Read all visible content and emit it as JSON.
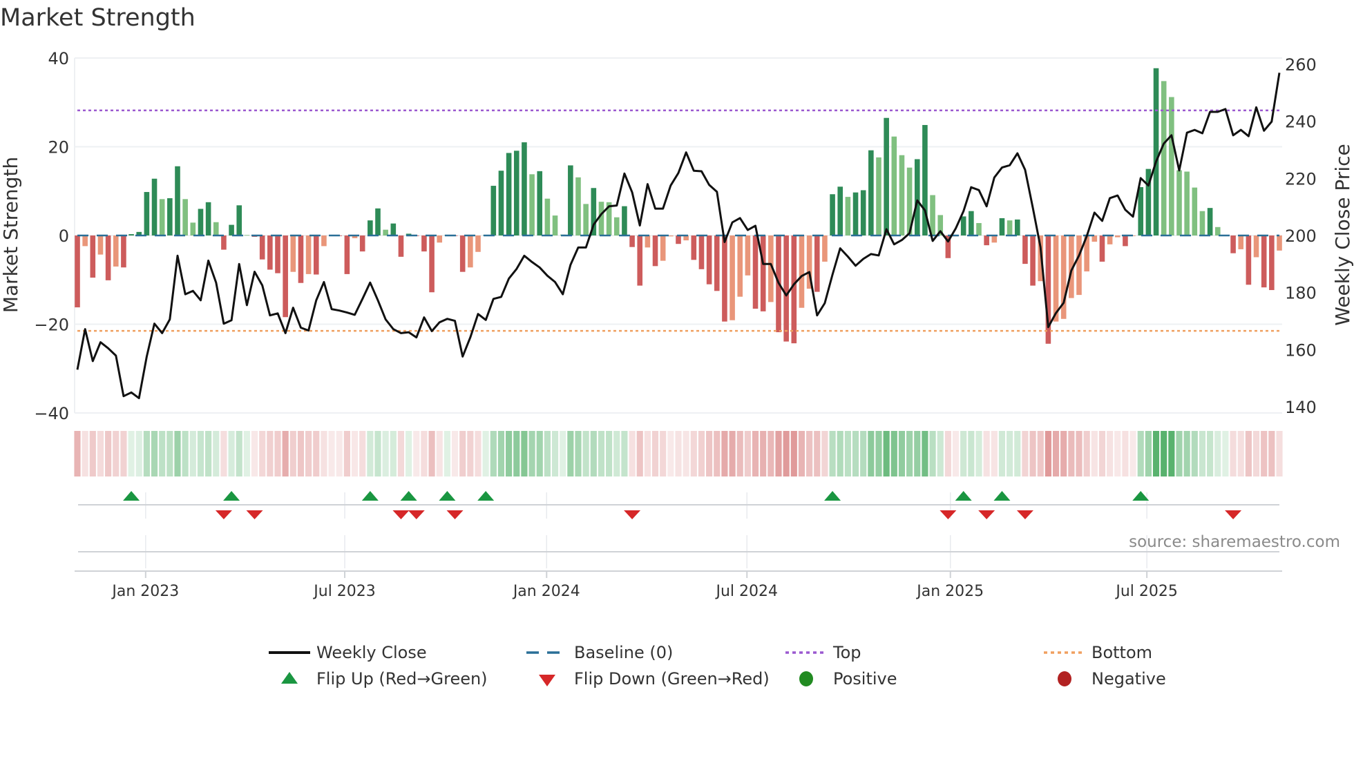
{
  "title": "Market Strength",
  "source": "source: sharemaestro.com",
  "colors": {
    "pos_strong": "#2e8b57",
    "pos_weak": "#80c080",
    "neg_strong": "#cd5c5c",
    "neg_weak": "#e9967a",
    "close": "#111111",
    "baseline": "#2a6f97",
    "top": "#9b59d0",
    "bottom": "#f0a060",
    "flip_up": "#1a9641",
    "flip_down": "#d62728",
    "positive": "#228b22",
    "negative": "#b22222"
  },
  "chart_data": {
    "type": "bar",
    "title": "Market Strength",
    "ylabel": "Market Strength",
    "y2label": "Weekly Close Price",
    "ylim": [
      -40,
      40
    ],
    "y2lim": [
      140,
      260
    ],
    "yticks": [
      40,
      20,
      0,
      -20,
      -40
    ],
    "ytick_labels": [
      "40",
      "20",
      "0",
      "−20",
      "−40"
    ],
    "y2ticks": [
      260,
      240,
      220,
      200,
      180,
      160,
      140
    ],
    "y2tick_labels": [
      "260",
      "240",
      "220",
      "200",
      "180",
      "160",
      "140"
    ],
    "xticks": [
      {
        "label": "Jan 2023",
        "week": 8.86
      },
      {
        "label": "Jul 2023",
        "week": 34.7
      },
      {
        "label": "Jan 2024",
        "week": 60.9
      },
      {
        "label": "Jul 2024",
        "week": 86.9
      },
      {
        "label": "Jan 2025",
        "week": 113.3
      },
      {
        "label": "Jul 2025",
        "week": 138.8
      }
    ],
    "top_level": 28.2,
    "bottom_level": -21.5,
    "baseline": 0,
    "strength": [
      -16.2,
      -2.4,
      -9.5,
      -4.3,
      -10.1,
      -7,
      -7.2,
      0.3,
      0.8,
      9.8,
      12.8,
      8.2,
      8.4,
      15.6,
      8.2,
      2.9,
      6,
      7.5,
      3,
      -3.2,
      2.4,
      6.8,
      0.1,
      -0.3,
      -5.4,
      -7.7,
      -8.5,
      -18.4,
      -8.2,
      -10.7,
      -8.7,
      -8.8,
      -2.4,
      -0.1,
      -0.1,
      -8.7,
      -0.6,
      -3.6,
      3.4,
      6.1,
      1.3,
      2.7,
      -4.8,
      0.4,
      -0.1,
      -3.6,
      -12.8,
      -1.6,
      0.1,
      -0.1,
      -8.2,
      -7.2,
      -3.7,
      0.1,
      11.2,
      14.6,
      18.6,
      19.1,
      21,
      13.8,
      14.5,
      8.3,
      4.5,
      0.2,
      15.8,
      13.1,
      7.1,
      10.7,
      7.6,
      7.5,
      4.1,
      6.6,
      -2.6,
      -11.3,
      -2.7,
      -6.9,
      -5.7,
      -0.2,
      -1.9,
      -1.1,
      -5.5,
      -7.6,
      -11,
      -12.5,
      -19.4,
      -19.1,
      -13.8,
      -9,
      -16.5,
      -17.1,
      -15,
      -21.8,
      -23.9,
      -24.3,
      -16.3,
      -12,
      -12.7,
      -5.9,
      9.3,
      11,
      8.7,
      9.7,
      10.2,
      19.2,
      17.6,
      26.5,
      22.3,
      18.1,
      15.3,
      17.2,
      24.9,
      9.1,
      4.6,
      -5.1,
      -0.2,
      4.3,
      5.5,
      2.8,
      -2.2,
      -1.6,
      3.9,
      3.4,
      3.6,
      -6.4,
      -11.3,
      -10.3,
      -24.4,
      -19.4,
      -18.8,
      -14.1,
      -13.4,
      -8.1,
      -1.4,
      -5.9,
      -2,
      -0.4,
      -2.4,
      -0.1,
      10.9,
      15,
      37.7,
      34.8,
      31.2,
      14.7,
      14.4,
      10.8,
      5.5,
      6.2,
      1.9,
      0.1,
      -4,
      -3.1,
      -11.1,
      -4.9,
      -11.7,
      -12.3,
      -3.4
    ],
    "weekly_close": [
      153,
      167.2,
      156,
      162.6,
      160.5,
      157.9,
      143.7,
      145,
      143,
      157.6,
      169.1,
      165.8,
      170.6,
      192.9,
      179.4,
      180.6,
      177.3,
      191.2,
      183.5,
      169.1,
      170.3,
      190,
      175.6,
      187.3,
      182.5,
      172,
      172.7,
      165.8,
      174.7,
      167.7,
      166.7,
      177.3,
      183.7,
      174.2,
      173.7,
      173,
      172.2,
      177.8,
      183.5,
      177.3,
      170.6,
      167.2,
      165.8,
      166.1,
      164.3,
      171.3,
      166.5,
      169.6,
      170.8,
      170.1,
      157.6,
      164.3,
      172.5,
      170.4,
      177.8,
      178.5,
      184.9,
      188.3,
      192.9,
      190.7,
      188.8,
      185.9,
      183.7,
      179.4,
      189.7,
      195.8,
      195.8,
      203.8,
      207.5,
      210.2,
      210.5,
      221.7,
      215.1,
      203.5,
      218,
      209.4,
      209.4,
      217.5,
      221.9,
      229.1,
      222.7,
      222.5,
      217.7,
      215.3,
      197.7,
      204.6,
      206.1,
      201.9,
      203.4,
      190,
      190,
      183.4,
      179,
      182.9,
      185.8,
      187.2,
      172,
      176.3,
      186.3,
      195.5,
      192.6,
      189.4,
      191.8,
      193.5,
      193,
      202.2,
      196.9,
      198.4,
      200.8,
      212.3,
      208.8,
      198.1,
      201.5,
      197.9,
      202.5,
      208.5,
      216.9,
      215.9,
      210.2,
      220.3,
      223.8,
      224.6,
      228.8,
      223,
      209.7,
      195.9,
      167.9,
      172.8,
      176.4,
      187.7,
      193,
      199.8,
      208,
      205.1,
      213.1,
      214,
      209,
      206.6,
      220.1,
      217.5,
      225.9,
      232.2,
      235.1,
      222.8,
      236,
      237,
      235.8,
      243.3,
      243.3,
      244.3,
      235.1,
      237,
      234.8,
      244.9,
      236.7,
      239.9,
      257
    ],
    "flip_up_weeks": [
      7,
      20,
      38,
      43,
      48,
      53,
      98,
      115,
      120,
      138
    ],
    "flip_down_weeks": [
      19,
      23,
      42,
      44,
      49,
      72,
      113,
      118,
      123,
      150
    ],
    "legend": {
      "position": "bottom",
      "items": [
        {
          "label": "Weekly Close",
          "symbol": "line"
        },
        {
          "label": "Baseline (0)",
          "symbol": "dash"
        },
        {
          "label": "Top",
          "symbol": "dot-purple"
        },
        {
          "label": "Bottom",
          "symbol": "dot-orange"
        },
        {
          "label": "Flip Up (Red→Green)",
          "symbol": "triangle-up"
        },
        {
          "label": "Flip Down (Green→Red)",
          "symbol": "triangle-down"
        },
        {
          "label": "Positive",
          "symbol": "circle-green"
        },
        {
          "label": "Negative",
          "symbol": "circle-red"
        }
      ]
    }
  }
}
